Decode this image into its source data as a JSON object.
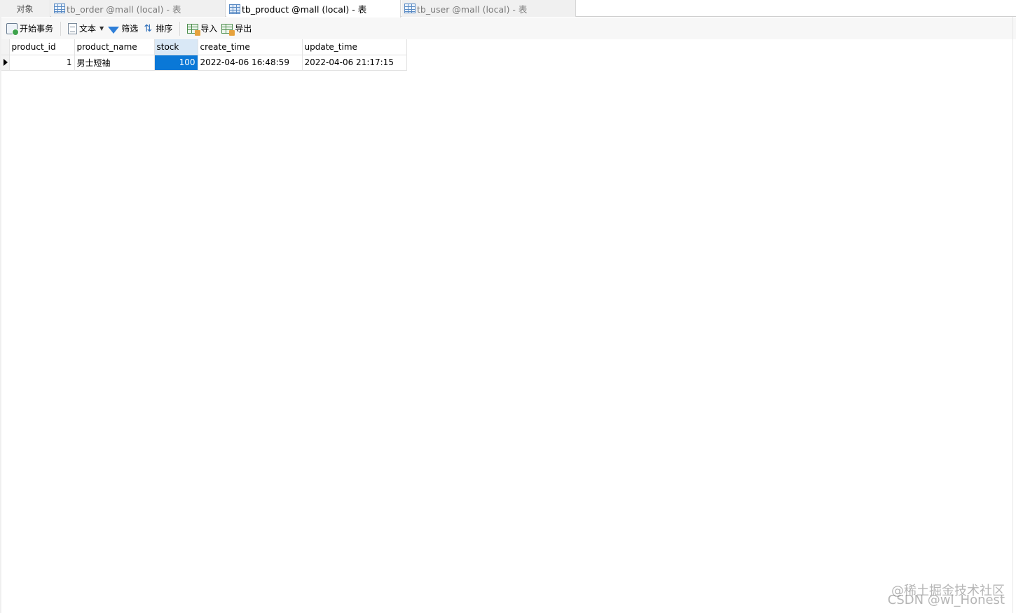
{
  "tabs": {
    "objects_label": "对象",
    "items": [
      {
        "label": "tb_order @mall (local) - 表",
        "active": false
      },
      {
        "label": "tb_product @mall (local) - 表",
        "active": true
      },
      {
        "label": "tb_user @mall (local) - 表",
        "active": false
      }
    ]
  },
  "toolbar": {
    "begin_transaction": "开始事务",
    "text": "文本",
    "filter": "筛选",
    "sort": "排序",
    "import": "导入",
    "export": "导出"
  },
  "grid": {
    "columns": [
      "product_id",
      "product_name",
      "stock",
      "create_time",
      "update_time"
    ],
    "rows": [
      {
        "product_id": "1",
        "product_name": "男士短袖",
        "stock": "100",
        "create_time": "2022-04-06 16:48:59",
        "update_time": "2022-04-06 21:17:15"
      }
    ],
    "selected_column": "stock"
  },
  "watermark": {
    "line1": "@稀土掘金技术社区",
    "line2": "CSDN @wl_Honest"
  },
  "colors": {
    "selection": "#0a78d7",
    "selected_header": "#d9e8f6"
  }
}
